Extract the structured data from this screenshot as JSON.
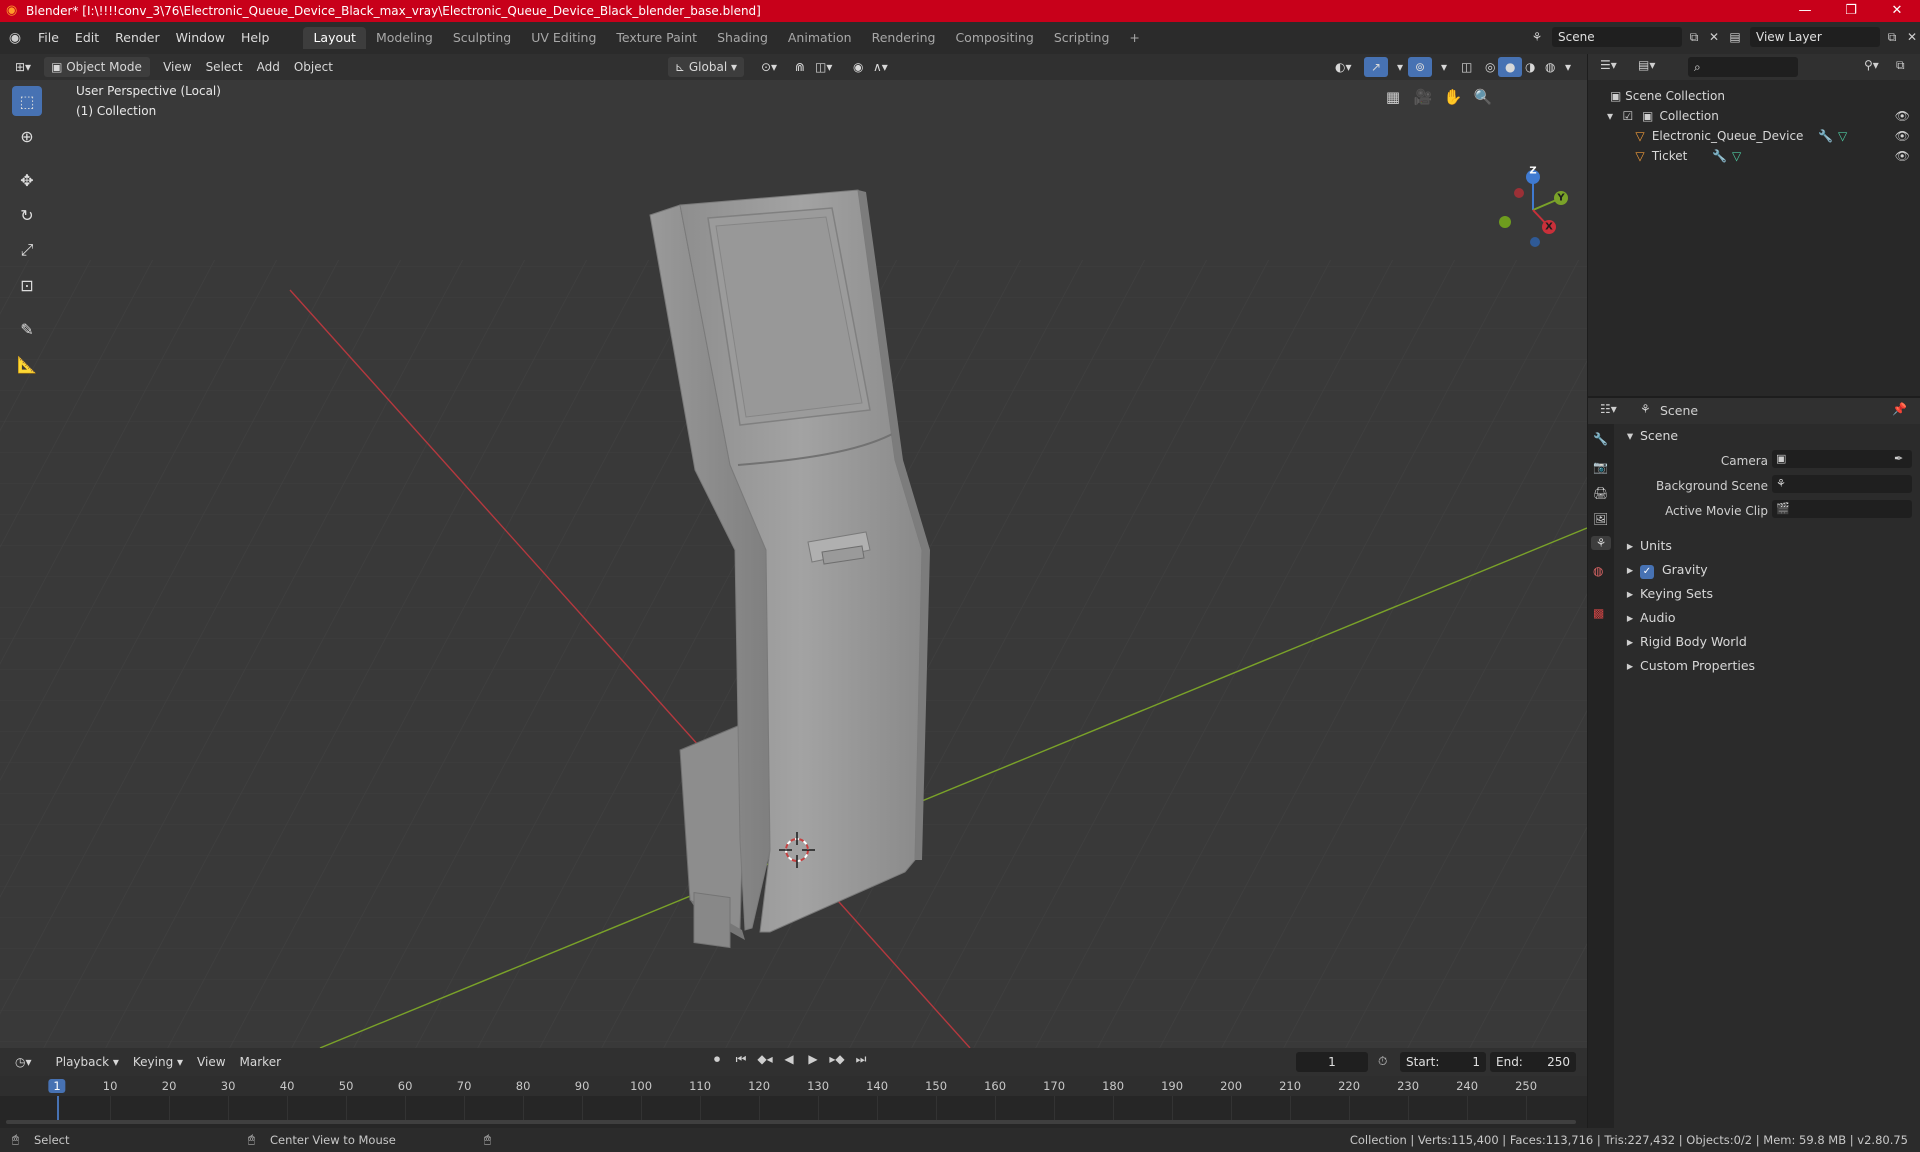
{
  "window": {
    "title": "Blender* [I:\\!!!!conv_3\\76\\Electronic_Queue_Device_Black_max_vray\\Electronic_Queue_Device_Black_blender_base.blend]",
    "minimize": "—",
    "maximize": "❐",
    "close": "✕"
  },
  "menu": [
    "File",
    "Edit",
    "Render",
    "Window",
    "Help"
  ],
  "workspaces": [
    {
      "label": "Layout",
      "active": true
    },
    {
      "label": "Modeling"
    },
    {
      "label": "Sculpting"
    },
    {
      "label": "UV Editing"
    },
    {
      "label": "Texture Paint"
    },
    {
      "label": "Shading"
    },
    {
      "label": "Animation"
    },
    {
      "label": "Rendering"
    },
    {
      "label": "Compositing"
    },
    {
      "label": "Scripting"
    }
  ],
  "add_workspace": "+",
  "scene_selector": {
    "value": "Scene"
  },
  "view_layer_selector": {
    "value": "View Layer"
  },
  "viewport_header": {
    "mode": "Object Mode",
    "menus": [
      "View",
      "Select",
      "Add",
      "Object"
    ],
    "transform_orientation": "Global"
  },
  "viewport": {
    "perspective": "User Perspective (Local)",
    "collection": "(1) Collection",
    "gizmo": {
      "x": "X",
      "y": "Y",
      "z": "Z"
    }
  },
  "outliner": {
    "search_placeholder": "",
    "root": "Scene Collection",
    "collection": "Collection",
    "items": [
      "Electronic_Queue_Device",
      "Ticket"
    ]
  },
  "properties": {
    "tab": "Scene",
    "section": "Scene",
    "fields": [
      {
        "label": "Camera",
        "value": ""
      },
      {
        "label": "Background Scene",
        "value": ""
      },
      {
        "label": "Active Movie Clip",
        "value": ""
      }
    ],
    "panels": [
      "Units",
      "Gravity",
      "Keying Sets",
      "Audio",
      "Rigid Body World",
      "Custom Properties"
    ],
    "gravity_checked": true
  },
  "timeline": {
    "menus": [
      "Playback",
      "Keying",
      "View",
      "Marker"
    ],
    "current_frame": "1",
    "start_label": "Start:",
    "start": "1",
    "end_label": "End:",
    "end": "250",
    "ruler": [
      "1",
      "10",
      "20",
      "30",
      "40",
      "50",
      "60",
      "70",
      "80",
      "90",
      "100",
      "110",
      "120",
      "130",
      "140",
      "150",
      "160",
      "170",
      "180",
      "190",
      "200",
      "210",
      "220",
      "230",
      "240",
      "250"
    ]
  },
  "status": {
    "left_action": "Select",
    "middle_action": "Center View to Mouse",
    "stats": "Collection | Verts:115,400 | Faces:113,716 | Tris:227,432 | Objects:0/2 | Mem: 59.8 MB | v2.80.75"
  },
  "colors": {
    "titlebar": "#c8001a",
    "accent": "#4772b3",
    "x_axis": "#b5383e",
    "y_axis": "#7aa229"
  }
}
